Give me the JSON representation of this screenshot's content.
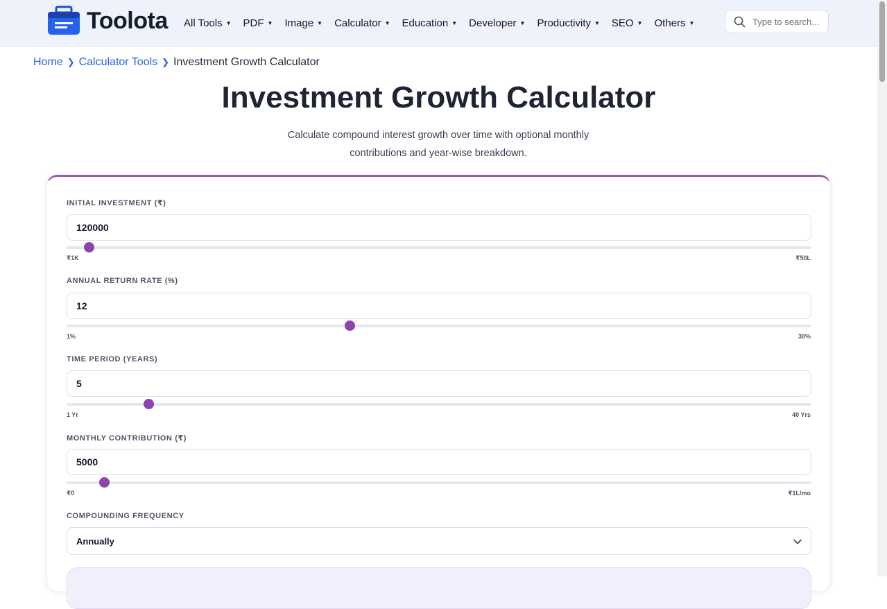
{
  "header": {
    "logo_text": "Toolota",
    "nav": [
      {
        "label": "All Tools"
      },
      {
        "label": "PDF"
      },
      {
        "label": "Image"
      },
      {
        "label": "Calculator"
      },
      {
        "label": "Education"
      },
      {
        "label": "Developer"
      },
      {
        "label": "Productivity"
      },
      {
        "label": "SEO"
      },
      {
        "label": "Others"
      }
    ],
    "search_placeholder": "Type to search..."
  },
  "breadcrumb": {
    "home": "Home",
    "category": "Calculator Tools",
    "current": "Investment Growth Calculator"
  },
  "page": {
    "title": "Investment Growth Calculator",
    "subtitle": "Calculate compound interest growth over time with optional monthly contributions and year-wise breakdown."
  },
  "fields": {
    "initial": {
      "label": "INITIAL INVESTMENT (₹)",
      "value": "120000",
      "min_label": "₹1K",
      "max_label": "₹50L",
      "level": 0.03
    },
    "rate": {
      "label": "ANNUAL RETURN RATE (%)",
      "value": "12",
      "min_label": "1%",
      "max_label": "30%",
      "level": 0.38
    },
    "period": {
      "label": "TIME PERIOD (YEARS)",
      "value": "5",
      "min_label": "1 Yr",
      "max_label": "40 Yrs",
      "level": 0.11
    },
    "monthly": {
      "label": "MONTHLY CONTRIBUTION (₹)",
      "value": "5000",
      "min_label": "₹0",
      "max_label": "₹1L/mo",
      "level": 0.05
    },
    "frequency": {
      "label": "COMPOUNDING FREQUENCY",
      "value": "Annually"
    }
  },
  "colors": {
    "accent": "#8e44ad",
    "link": "#2563eb"
  }
}
